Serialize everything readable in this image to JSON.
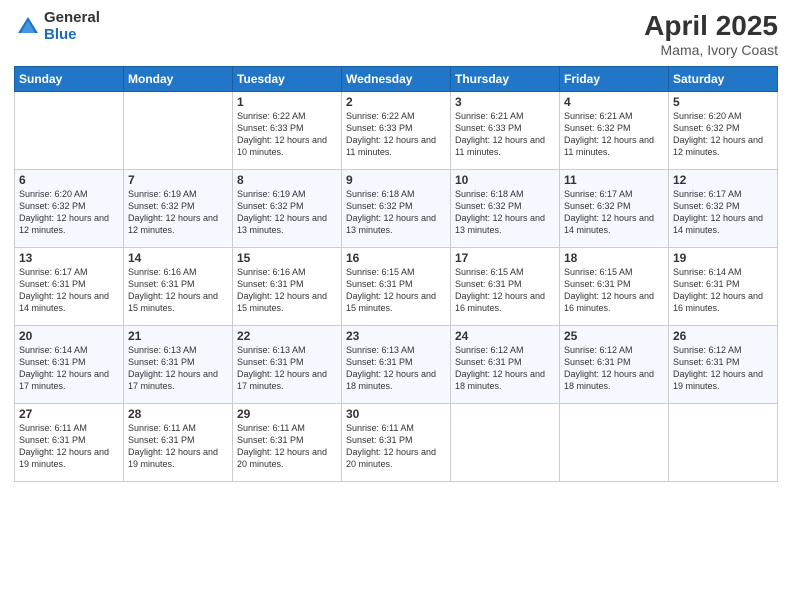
{
  "logo": {
    "general": "General",
    "blue": "Blue"
  },
  "title": {
    "month": "April 2025",
    "location": "Mama, Ivory Coast"
  },
  "weekdays": [
    "Sunday",
    "Monday",
    "Tuesday",
    "Wednesday",
    "Thursday",
    "Friday",
    "Saturday"
  ],
  "weeks": [
    [
      {
        "day": null
      },
      {
        "day": null
      },
      {
        "day": "1",
        "sunrise": "Sunrise: 6:22 AM",
        "sunset": "Sunset: 6:33 PM",
        "daylight": "Daylight: 12 hours and 10 minutes."
      },
      {
        "day": "2",
        "sunrise": "Sunrise: 6:22 AM",
        "sunset": "Sunset: 6:33 PM",
        "daylight": "Daylight: 12 hours and 11 minutes."
      },
      {
        "day": "3",
        "sunrise": "Sunrise: 6:21 AM",
        "sunset": "Sunset: 6:33 PM",
        "daylight": "Daylight: 12 hours and 11 minutes."
      },
      {
        "day": "4",
        "sunrise": "Sunrise: 6:21 AM",
        "sunset": "Sunset: 6:32 PM",
        "daylight": "Daylight: 12 hours and 11 minutes."
      },
      {
        "day": "5",
        "sunrise": "Sunrise: 6:20 AM",
        "sunset": "Sunset: 6:32 PM",
        "daylight": "Daylight: 12 hours and 12 minutes."
      }
    ],
    [
      {
        "day": "6",
        "sunrise": "Sunrise: 6:20 AM",
        "sunset": "Sunset: 6:32 PM",
        "daylight": "Daylight: 12 hours and 12 minutes."
      },
      {
        "day": "7",
        "sunrise": "Sunrise: 6:19 AM",
        "sunset": "Sunset: 6:32 PM",
        "daylight": "Daylight: 12 hours and 12 minutes."
      },
      {
        "day": "8",
        "sunrise": "Sunrise: 6:19 AM",
        "sunset": "Sunset: 6:32 PM",
        "daylight": "Daylight: 12 hours and 13 minutes."
      },
      {
        "day": "9",
        "sunrise": "Sunrise: 6:18 AM",
        "sunset": "Sunset: 6:32 PM",
        "daylight": "Daylight: 12 hours and 13 minutes."
      },
      {
        "day": "10",
        "sunrise": "Sunrise: 6:18 AM",
        "sunset": "Sunset: 6:32 PM",
        "daylight": "Daylight: 12 hours and 13 minutes."
      },
      {
        "day": "11",
        "sunrise": "Sunrise: 6:17 AM",
        "sunset": "Sunset: 6:32 PM",
        "daylight": "Daylight: 12 hours and 14 minutes."
      },
      {
        "day": "12",
        "sunrise": "Sunrise: 6:17 AM",
        "sunset": "Sunset: 6:32 PM",
        "daylight": "Daylight: 12 hours and 14 minutes."
      }
    ],
    [
      {
        "day": "13",
        "sunrise": "Sunrise: 6:17 AM",
        "sunset": "Sunset: 6:31 PM",
        "daylight": "Daylight: 12 hours and 14 minutes."
      },
      {
        "day": "14",
        "sunrise": "Sunrise: 6:16 AM",
        "sunset": "Sunset: 6:31 PM",
        "daylight": "Daylight: 12 hours and 15 minutes."
      },
      {
        "day": "15",
        "sunrise": "Sunrise: 6:16 AM",
        "sunset": "Sunset: 6:31 PM",
        "daylight": "Daylight: 12 hours and 15 minutes."
      },
      {
        "day": "16",
        "sunrise": "Sunrise: 6:15 AM",
        "sunset": "Sunset: 6:31 PM",
        "daylight": "Daylight: 12 hours and 15 minutes."
      },
      {
        "day": "17",
        "sunrise": "Sunrise: 6:15 AM",
        "sunset": "Sunset: 6:31 PM",
        "daylight": "Daylight: 12 hours and 16 minutes."
      },
      {
        "day": "18",
        "sunrise": "Sunrise: 6:15 AM",
        "sunset": "Sunset: 6:31 PM",
        "daylight": "Daylight: 12 hours and 16 minutes."
      },
      {
        "day": "19",
        "sunrise": "Sunrise: 6:14 AM",
        "sunset": "Sunset: 6:31 PM",
        "daylight": "Daylight: 12 hours and 16 minutes."
      }
    ],
    [
      {
        "day": "20",
        "sunrise": "Sunrise: 6:14 AM",
        "sunset": "Sunset: 6:31 PM",
        "daylight": "Daylight: 12 hours and 17 minutes."
      },
      {
        "day": "21",
        "sunrise": "Sunrise: 6:13 AM",
        "sunset": "Sunset: 6:31 PM",
        "daylight": "Daylight: 12 hours and 17 minutes."
      },
      {
        "day": "22",
        "sunrise": "Sunrise: 6:13 AM",
        "sunset": "Sunset: 6:31 PM",
        "daylight": "Daylight: 12 hours and 17 minutes."
      },
      {
        "day": "23",
        "sunrise": "Sunrise: 6:13 AM",
        "sunset": "Sunset: 6:31 PM",
        "daylight": "Daylight: 12 hours and 18 minutes."
      },
      {
        "day": "24",
        "sunrise": "Sunrise: 6:12 AM",
        "sunset": "Sunset: 6:31 PM",
        "daylight": "Daylight: 12 hours and 18 minutes."
      },
      {
        "day": "25",
        "sunrise": "Sunrise: 6:12 AM",
        "sunset": "Sunset: 6:31 PM",
        "daylight": "Daylight: 12 hours and 18 minutes."
      },
      {
        "day": "26",
        "sunrise": "Sunrise: 6:12 AM",
        "sunset": "Sunset: 6:31 PM",
        "daylight": "Daylight: 12 hours and 19 minutes."
      }
    ],
    [
      {
        "day": "27",
        "sunrise": "Sunrise: 6:11 AM",
        "sunset": "Sunset: 6:31 PM",
        "daylight": "Daylight: 12 hours and 19 minutes."
      },
      {
        "day": "28",
        "sunrise": "Sunrise: 6:11 AM",
        "sunset": "Sunset: 6:31 PM",
        "daylight": "Daylight: 12 hours and 19 minutes."
      },
      {
        "day": "29",
        "sunrise": "Sunrise: 6:11 AM",
        "sunset": "Sunset: 6:31 PM",
        "daylight": "Daylight: 12 hours and 20 minutes."
      },
      {
        "day": "30",
        "sunrise": "Sunrise: 6:11 AM",
        "sunset": "Sunset: 6:31 PM",
        "daylight": "Daylight: 12 hours and 20 minutes."
      },
      {
        "day": null
      },
      {
        "day": null
      },
      {
        "day": null
      }
    ]
  ]
}
